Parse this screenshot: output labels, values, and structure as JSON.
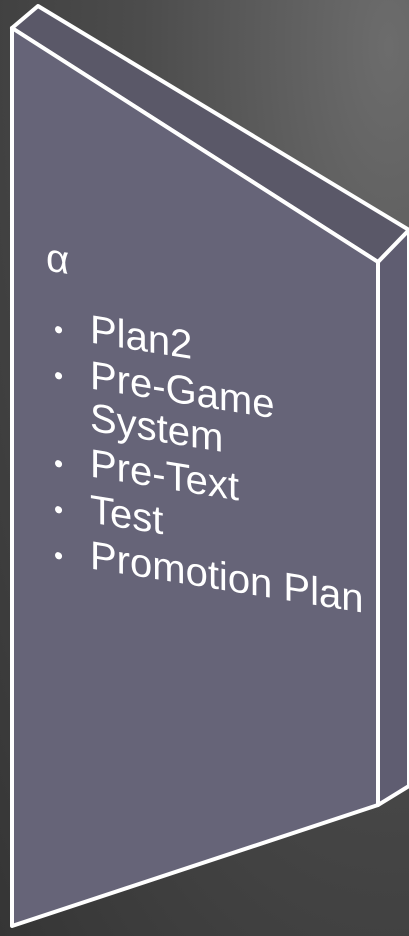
{
  "panel": {
    "heading": "α",
    "bullets": [
      "Plan2",
      "Pre-Game System",
      "Pre-Text",
      "Test",
      "Promotion Plan"
    ]
  },
  "colors": {
    "background": "#454545",
    "panel_face": "#666478",
    "panel_edge": "#5f5d71",
    "panel_top": "#5a5868",
    "outline": "#ffffff",
    "text": "#ffffff"
  }
}
